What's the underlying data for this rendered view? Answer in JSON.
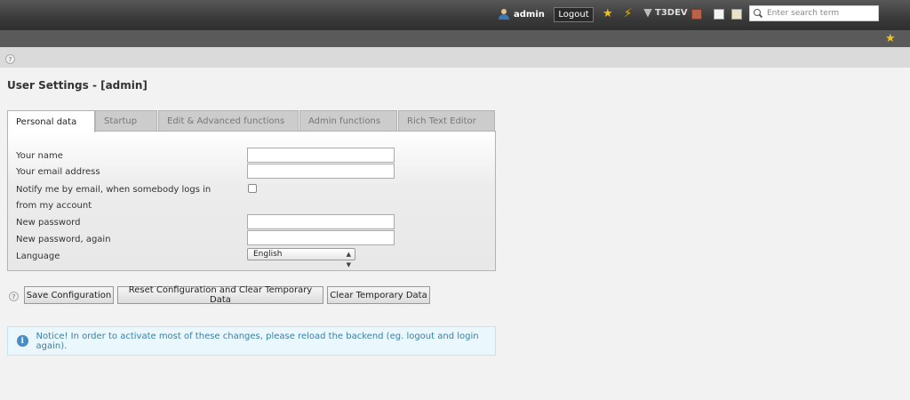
{
  "topbar": {
    "username": "admin",
    "logout_label": "Logout",
    "workspace_label": "T3DEV",
    "search_placeholder": "Enter search term",
    "icons": [
      "user-icon",
      "bookmark-star-icon",
      "clear-cache-icon",
      "t3-logo-icon",
      "workspace-icon",
      "document-icon",
      "edit-icon"
    ],
    "accent_star": "#f1c21b",
    "accent_bolt": "#f1b800"
  },
  "page": {
    "title": "User Settings - [admin]"
  },
  "tabs": [
    {
      "label": "Personal data",
      "active": true
    },
    {
      "label": "Startup",
      "active": false
    },
    {
      "label": "Edit & Advanced functions",
      "active": false
    },
    {
      "label": "Admin functions",
      "active": false
    },
    {
      "label": "Rich Text Editor",
      "active": false
    }
  ],
  "form": {
    "name_label": "Your name",
    "name_value": "",
    "email_label": "Your email address",
    "email_value": "",
    "notify_label_1": "Notify me by email, when somebody logs in",
    "notify_label_2": "from my account",
    "notify_checked": false,
    "password_label": "New password",
    "password_again_label": "New password, again",
    "language_label": "Language",
    "language_value": "English"
  },
  "buttons": {
    "save": "Save Configuration",
    "reset": "Reset Configuration and Clear Temporary Data",
    "clear": "Clear Temporary Data"
  },
  "notice": {
    "text": "Notice! In order to activate most of these changes, please reload the backend (eg. logout and login again)."
  }
}
